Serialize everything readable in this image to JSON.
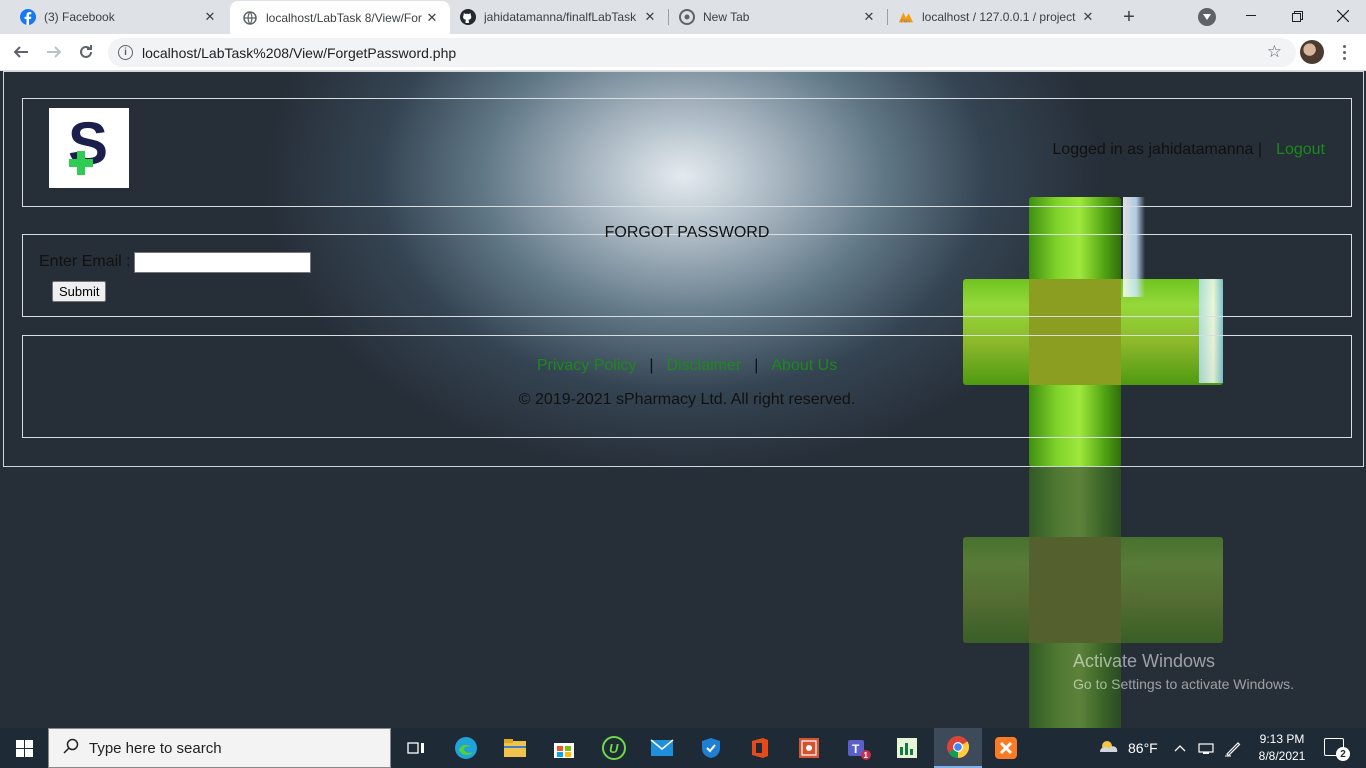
{
  "browser": {
    "tabs": [
      {
        "title": "(3) Facebook",
        "icon": "facebook-icon"
      },
      {
        "title": "localhost/LabTask 8/View/For",
        "icon": "globe-icon",
        "active": true
      },
      {
        "title": "jahidatamanna/finalfLabTask",
        "icon": "github-icon"
      },
      {
        "title": "New Tab",
        "icon": "chrome-icon"
      },
      {
        "title": "localhost / 127.0.0.1 / project",
        "icon": "phpmyadmin-icon"
      }
    ],
    "url": "localhost/LabTask%208/View/ForgetPassword.php"
  },
  "page": {
    "header": {
      "logged_in_text": "Logged in as jahidatamanna |",
      "logout_label": "Logout"
    },
    "form": {
      "legend": "FORGOT PASSWORD",
      "email_label": "Enter Email :",
      "email_value": "",
      "submit_label": "Submit"
    },
    "footer": {
      "links": [
        "Privacy Policy",
        "Disclaimer",
        "About Us"
      ],
      "separator": "|",
      "copyright": "© 2019-2021 sPharmacy Ltd. All right reserved."
    },
    "watermark": {
      "title": "Activate Windows",
      "subtitle": "Go to Settings to activate Windows."
    }
  },
  "taskbar": {
    "search_placeholder": "Type here to search",
    "weather": "86°F",
    "time": "9:13 PM",
    "date": "8/8/2021",
    "notification_count": "2",
    "teams_badge": "1"
  },
  "colors": {
    "link_green": "#1a8a1a",
    "taskbar_bg": "#1f2a37",
    "tabstrip_bg": "#dee1e6"
  }
}
